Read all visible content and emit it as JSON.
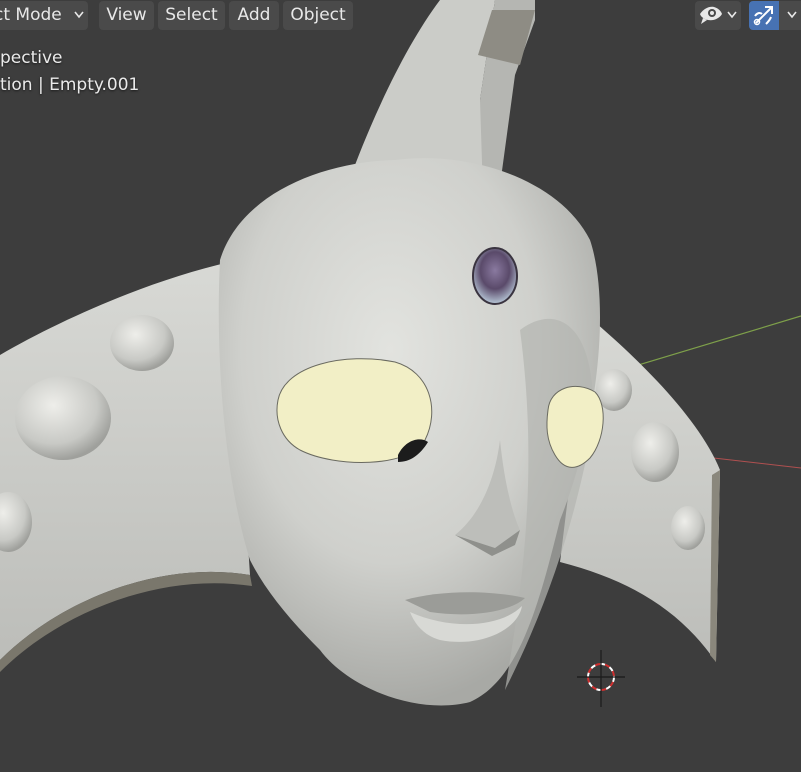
{
  "header": {
    "mode_label": "ct Mode",
    "menus": [
      "View",
      "Select",
      "Add",
      "Object"
    ]
  },
  "overlay": {
    "view_name": "pective",
    "collection_line": "tion | Empty.001"
  },
  "icons": {
    "mode": "chevron-down-icon",
    "visibility": "eye-icon",
    "gizmo": "gizmo-arrow-icon",
    "cursor": "3d-cursor-icon"
  },
  "colors": {
    "viewport_bg": "#3d3d3d",
    "header_button": "#4a4a4a",
    "active_toggle": "#4772b3",
    "mask_body": "#d2d3cf",
    "eye_fill": "#f2efc6",
    "axis_x": "#b05050",
    "axis_y": "#7ea04a"
  }
}
